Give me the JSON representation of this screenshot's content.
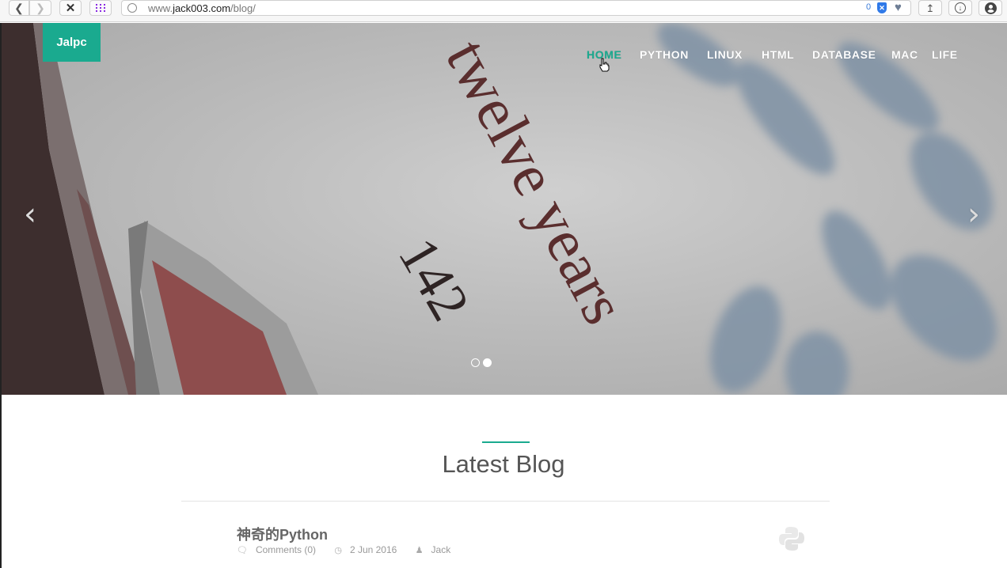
{
  "browser": {
    "url_prefix": "www.",
    "url_domain": "jack003.com",
    "url_path": "/blog/",
    "blocker_count": "0"
  },
  "site": {
    "brand": "Jalpc",
    "nav": [
      "HOME",
      "PYTHON",
      "LINUX",
      "HTML",
      "DATABASE",
      "MAC",
      "LIFE"
    ],
    "active_nav": "HOME",
    "accent_color": "#1aaa8f"
  },
  "carousel": {
    "slide_count": 2,
    "active_slide": 2,
    "image_text": [
      "twelve years",
      "142"
    ]
  },
  "section": {
    "title": "Latest Blog"
  },
  "posts": [
    {
      "title": "神奇的Python",
      "comments": "Comments (0)",
      "date": "2 Jun 2016",
      "author": "Jack",
      "icon": "python-icon"
    }
  ]
}
